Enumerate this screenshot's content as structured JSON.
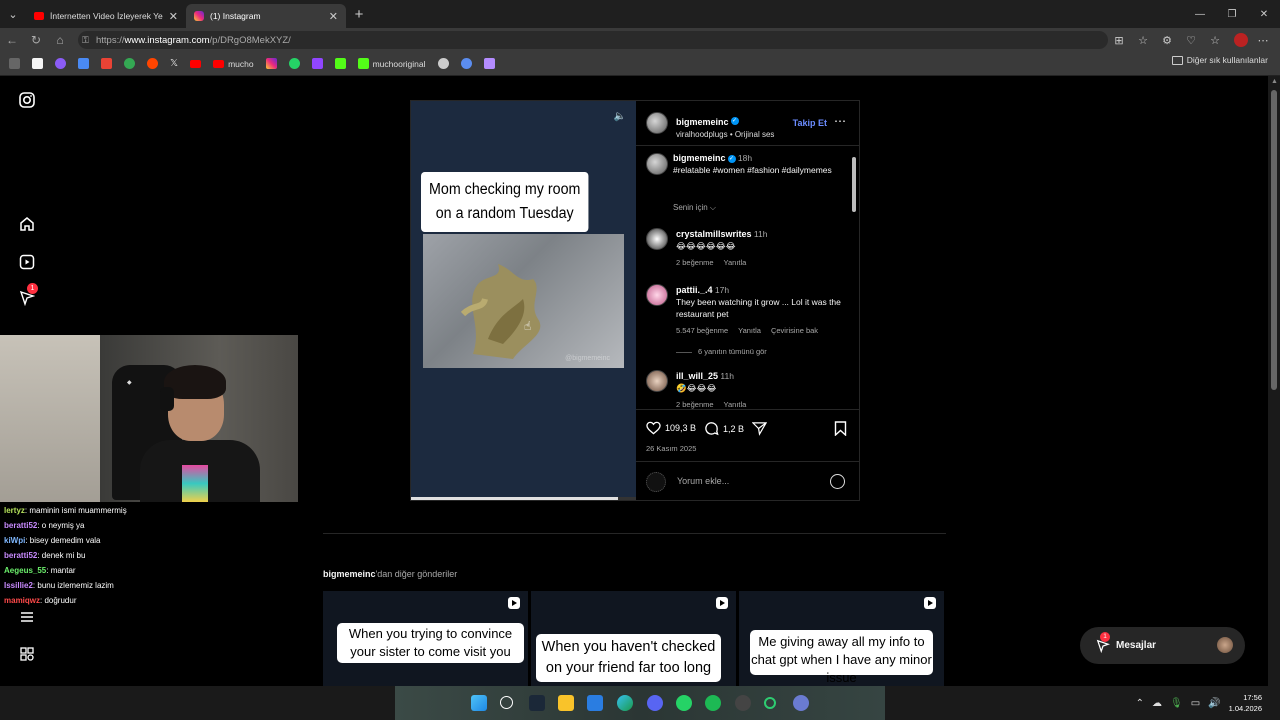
{
  "browser": {
    "tabs": [
      {
        "title": "İnternetten Video İzleyerek Yemek",
        "icon": "youtube-icon"
      },
      {
        "title": "(1) Instagram",
        "icon": "instagram-icon",
        "active": true
      }
    ],
    "url_prefix": "https://",
    "url_host": "www.instagram.com",
    "url_path": "/p/DRgO8MekXYZ/",
    "bookmarks": [
      "mucho",
      "muchooriginal"
    ],
    "other_bookmarks": "Diğer sık kullanılanlar"
  },
  "post": {
    "author": "bigmemeinc",
    "audio": "viralhoodplugs • Orijinal ses",
    "follow_label": "Takip Et",
    "caption_text": "Mom checking my room on a random  Tuesday",
    "watermark": "@bigmemeinc",
    "caption_author": "bigmemeinc",
    "caption_time": "18h",
    "hashtags": "#relatable #women #fashion #dailymemes",
    "sort_label": "Senin için",
    "likes": "109,3 B",
    "comments_count": "1,2 B",
    "date": "26 Kasım 2025",
    "comment_placeholder": "Yorum ekle...",
    "progress": 0.92
  },
  "comments": [
    {
      "user": "crystalmillswrites",
      "time": "11h",
      "text": "😂😂😂😂😂😂",
      "likes": "2 beğenme",
      "reply": "Yanıtla"
    },
    {
      "user": "pattii._.4",
      "time": "17h",
      "text": "They been watching it grow ... Lol it was the restaurant pet",
      "likes": "5.547 beğenme",
      "reply": "Yanıtla",
      "translate": "Çevirisine bak"
    },
    {
      "user": "ill_will_25",
      "time": "11h",
      "text": "🤣😂😂😂",
      "likes": "2 beğenme",
      "reply": "Yanıtla"
    }
  ],
  "view_replies": "6 yanıtın tümünü gör",
  "more_posts": {
    "author": "bigmemeinc",
    "suffix": "'dan diğer gönderiler",
    "items": [
      "When you trying to convince your sister to come visit you",
      "When you haven't checked on your friend far too long",
      "Me giving away all my info to chat gpt when I have any minor issue"
    ]
  },
  "messages": {
    "label": "Mesajlar",
    "badge": "1"
  },
  "sidebar_badge": "1",
  "chat": [
    {
      "user": "lertyz",
      "color": "#b6e35b",
      "text": ": maminin ismi muammermiş"
    },
    {
      "user": "beratti52",
      "color": "#c98bff",
      "text": ": o neymiş ya"
    },
    {
      "user": "kiWpi",
      "color": "#7fb8ff",
      "text": ": bisey demedim vala"
    },
    {
      "user": "beratti52",
      "color": "#c98bff",
      "text": ": denek mi bu"
    },
    {
      "user": "Aegeus_55",
      "color": "#6cf06c",
      "text": ": mantar"
    },
    {
      "user": "Issillie2",
      "color": "#c98bff",
      "text": ": bunu izlememiz lazim"
    },
    {
      "user": "mamiqwz",
      "color": "#ff4a4a",
      "text": ": doğrudur"
    }
  ],
  "clock": {
    "time": "17:56",
    "date": "1.04.2026"
  },
  "colors": {
    "accent": "#0095f6",
    "follow": "#6b8cff",
    "badge": "#ff3040"
  }
}
